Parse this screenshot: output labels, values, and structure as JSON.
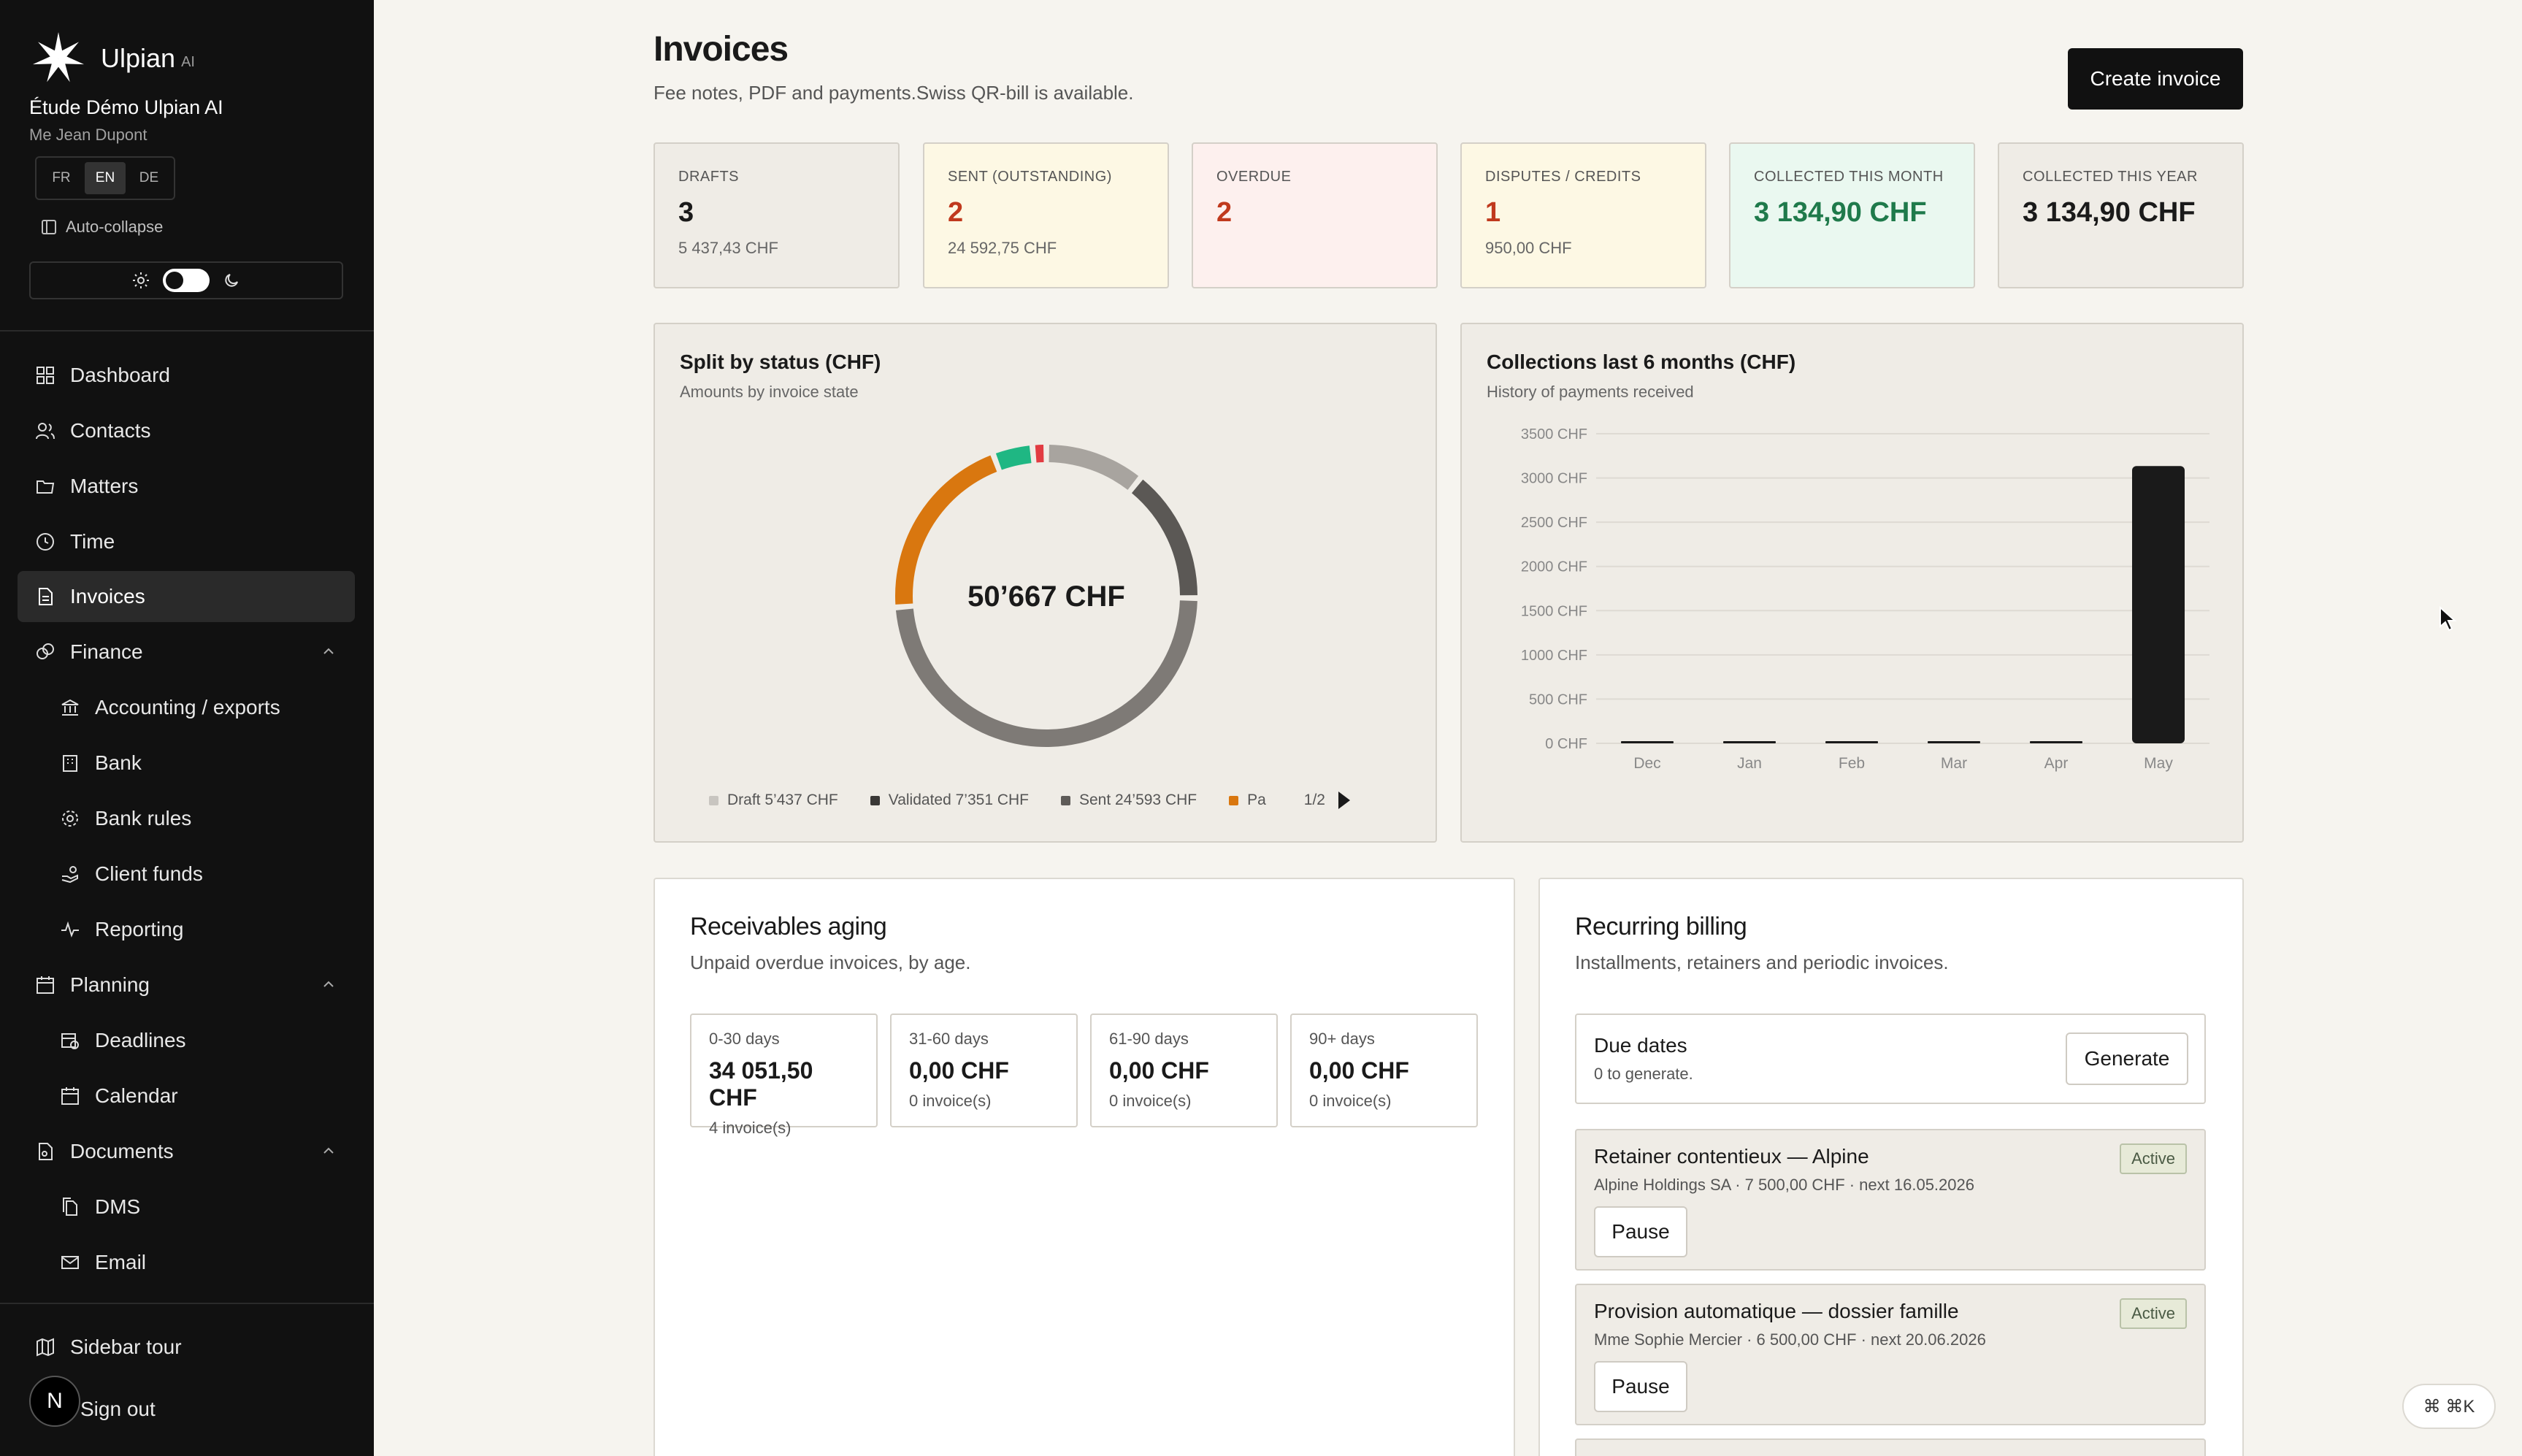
{
  "sidebar": {
    "brand": {
      "name": "Ulpian",
      "suffix": "AI"
    },
    "firm_name": "Étude Démo Ulpian AI",
    "user_name": "Me Jean Dupont",
    "languages": [
      "FR",
      "EN",
      "DE"
    ],
    "active_language": "EN",
    "auto_collapse_label": "Auto-collapse",
    "nav": {
      "dashboard": "Dashboard",
      "contacts": "Contacts",
      "matters": "Matters",
      "time": "Time",
      "invoices": "Invoices",
      "finance": "Finance",
      "accounting": "Accounting / exports",
      "bank": "Bank",
      "bank_rules": "Bank rules",
      "client_funds": "Client funds",
      "reporting": "Reporting",
      "planning": "Planning",
      "deadlines": "Deadlines",
      "calendar": "Calendar",
      "documents": "Documents",
      "dms": "DMS",
      "email": "Email"
    },
    "sidebar_tour": "Sidebar tour",
    "sign_out": "Sign out",
    "avatar_letter": "N"
  },
  "header": {
    "title": "Invoices",
    "subtitle": "Fee notes, PDF and payments.Swiss QR-bill is available.",
    "create_button": "Create invoice"
  },
  "kpis": [
    {
      "label": "DRAFTS",
      "value": "3",
      "sub": "5 437,43 CHF",
      "bg": "#efece6",
      "color": "#1a1a1a"
    },
    {
      "label": "SENT (OUTSTANDING)",
      "value": "2",
      "sub": "24 592,75 CHF",
      "bg": "#fdf8e4",
      "color": "#c0391d"
    },
    {
      "label": "OVERDUE",
      "value": "2",
      "sub": "",
      "bg": "#fdf0ee",
      "color": "#c0391d"
    },
    {
      "label": "DISPUTES / CREDITS",
      "value": "1",
      "sub": "950,00 CHF",
      "bg": "#fdf8e4",
      "color": "#c0391d"
    },
    {
      "label": "COLLECTED THIS MONTH",
      "value": "3 134,90 CHF",
      "sub": "",
      "bg": "#eaf8f0",
      "color": "#1f7a4b"
    },
    {
      "label": "COLLECTED THIS YEAR",
      "value": "3 134,90 CHF",
      "sub": "",
      "bg": "#efece6",
      "color": "#1a1a1a"
    }
  ],
  "status_chart": {
    "title": "Split by status (CHF)",
    "subtitle": "Amounts by invoice state",
    "center_label": "50’667 CHF",
    "legend_page": "1/2",
    "legend_truncated": "Pa",
    "legend_truncated_color": "#d9770f"
  },
  "collections_chart": {
    "title": "Collections last 6 months (CHF)",
    "subtitle": "History of payments received"
  },
  "chart_data": [
    {
      "type": "pie",
      "title": "Split by status (CHF)",
      "center_total": "50’667 CHF",
      "slices": [
        {
          "name": "Draft",
          "label": "5’437 CHF",
          "value": 5437,
          "color": "#a8a49f"
        },
        {
          "name": "Validated",
          "label": "7’351 CHF",
          "value": 7351,
          "color": "#5b5855"
        },
        {
          "name": "Sent",
          "label": "24’593 CHF",
          "value": 24593,
          "color": "#7e7a76"
        },
        {
          "name": "",
          "value": 10386,
          "color": "#d9770f"
        },
        {
          "name": "",
          "value": 2150,
          "color": "#1fb783"
        },
        {
          "name": "",
          "value": 750,
          "color": "#e23b42"
        }
      ]
    },
    {
      "type": "bar",
      "title": "Collections last 6 months (CHF)",
      "categories": [
        "Dec",
        "Jan",
        "Feb",
        "Mar",
        "Apr",
        "May"
      ],
      "values": [
        0,
        0,
        0,
        0,
        0,
        3134.9
      ],
      "y_ticks": [
        "0 CHF",
        "500 CHF",
        "1000 CHF",
        "1500 CHF",
        "2000 CHF",
        "2500 CHF",
        "3000 CHF",
        "3500 CHF"
      ],
      "ylim": [
        0,
        3500
      ],
      "grid": true,
      "bar_color": "#1a1a1a"
    }
  ],
  "aging": {
    "title": "Receivables aging",
    "subtitle": "Unpaid overdue invoices, by age.",
    "buckets": [
      {
        "label": "0-30 days",
        "amount": "34 051,50 CHF",
        "count": "4 invoice(s)"
      },
      {
        "label": "31-60 days",
        "amount": "0,00 CHF",
        "count": "0 invoice(s)"
      },
      {
        "label": "61-90 days",
        "amount": "0,00 CHF",
        "count": "0 invoice(s)"
      },
      {
        "label": "90+ days",
        "amount": "0,00 CHF",
        "count": "0 invoice(s)"
      }
    ]
  },
  "recurring": {
    "title": "Recurring billing",
    "subtitle": "Installments, retainers and periodic invoices.",
    "due": {
      "title": "Due dates",
      "sub": "0 to generate.",
      "button": "Generate"
    },
    "items": [
      {
        "title": "Retainer contentieux — Alpine",
        "sub": "Alpine Holdings SA · 7 500,00 CHF · next 16.05.2026",
        "status": "Active",
        "button": "Pause"
      },
      {
        "title": "Provision automatique — dossier famille",
        "sub": "Mme Sophie Mercier · 6 500,00 CHF · next 20.06.2026",
        "status": "Active",
        "button": "Pause"
      }
    ]
  },
  "shortcut": "⌘ ⌘K"
}
